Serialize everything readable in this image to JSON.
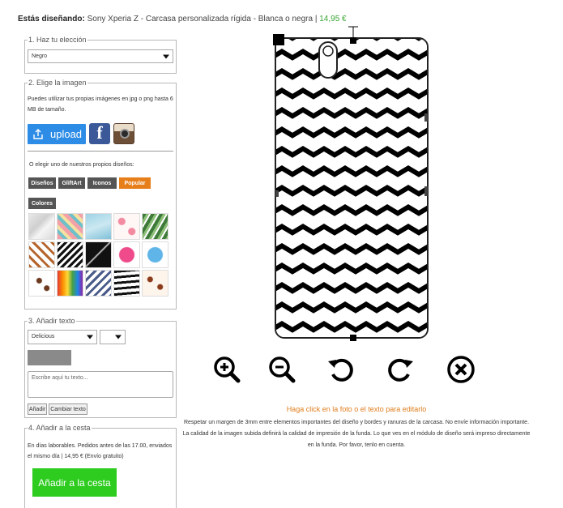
{
  "header": {
    "label": "Estás diseñando:",
    "product": "Sony Xperia Z - Carcasa personalizada rígida - Blanca o negra |",
    "price": "14,95 €"
  },
  "step1": {
    "legend": "1. Haz tu elección",
    "selected": "Negro"
  },
  "step2": {
    "legend": "2. Elige la imagen",
    "instructions": "Puedes utilizar tus propias imágenes en jpg o png hasta 6 MB de tamaño.",
    "upload_label": "upload",
    "own_designs_text": "O elegir uno de nuestros propios diseños:",
    "categories": [
      "Diseños",
      "GliftArt",
      "Iconos",
      "Popular",
      "Colores"
    ],
    "active_category": "Popular"
  },
  "step3": {
    "legend": "3. Añadir texto",
    "font": "Delicious",
    "size": "",
    "text_placeholder": "Escribe aquí tu texto...",
    "add_button": "Añadir",
    "change_button": "Cambiar texto"
  },
  "step4": {
    "legend": "4. Añadir a la cesta",
    "info": "En días laborables. Pedidos antes de las 17.00, enviados el mismo día | 14,95 € (Envío gratuito)",
    "cart_button": "Añadir a la cesta"
  },
  "editor": {
    "hint": "Haga click en la foto o el texto para editarlo",
    "notes": "Respetar un margen de 3mm entre elementos importantes del diseño y bordes y ranuras de la carcasa. No envíe información importante. La calidad de la imagen subida definirá la calidad de impresión de la funda. Lo que ves en el módulo de diseño será impreso directamente en la funda. Por favor, tenlo en cuenta.",
    "tools": [
      "zoom-in-icon",
      "zoom-out-icon",
      "rotate-left-icon",
      "rotate-right-icon",
      "delete-icon"
    ]
  },
  "colors": {
    "accent_price": "#3aa635",
    "upload": "#2d8de6",
    "active_category": "#e67e1a",
    "cart_button": "#2ecc1f",
    "hint": "#e07d1e"
  }
}
